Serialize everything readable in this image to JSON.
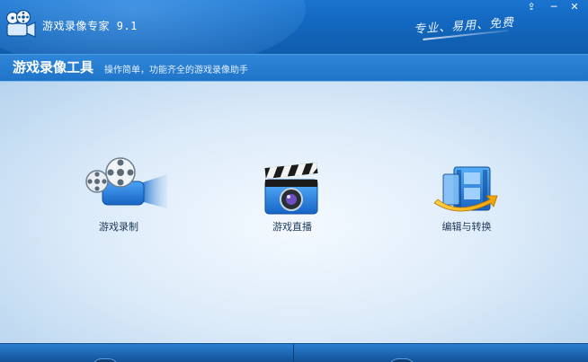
{
  "window": {
    "app_title": "游戏录像专家 9.1",
    "slogan": "专业、易用、免费",
    "controls": {
      "menu": "⇪",
      "minimize": "─",
      "close": "✕"
    }
  },
  "header": {
    "title": "游戏录像工具",
    "subtitle": "操作简单，功能齐全的游戏录像助手"
  },
  "tiles": [
    {
      "label": "游戏录制",
      "icon": "film-reel-camera-icon"
    },
    {
      "label": "游戏直播",
      "icon": "clapperboard-lens-icon"
    },
    {
      "label": "编辑与转换",
      "icon": "film-convert-arrow-icon"
    }
  ],
  "colors": {
    "titlebar": "#1368c0",
    "header": "#1f74c8",
    "background": "#dcebf9",
    "label_text": "#1d3a5a"
  }
}
